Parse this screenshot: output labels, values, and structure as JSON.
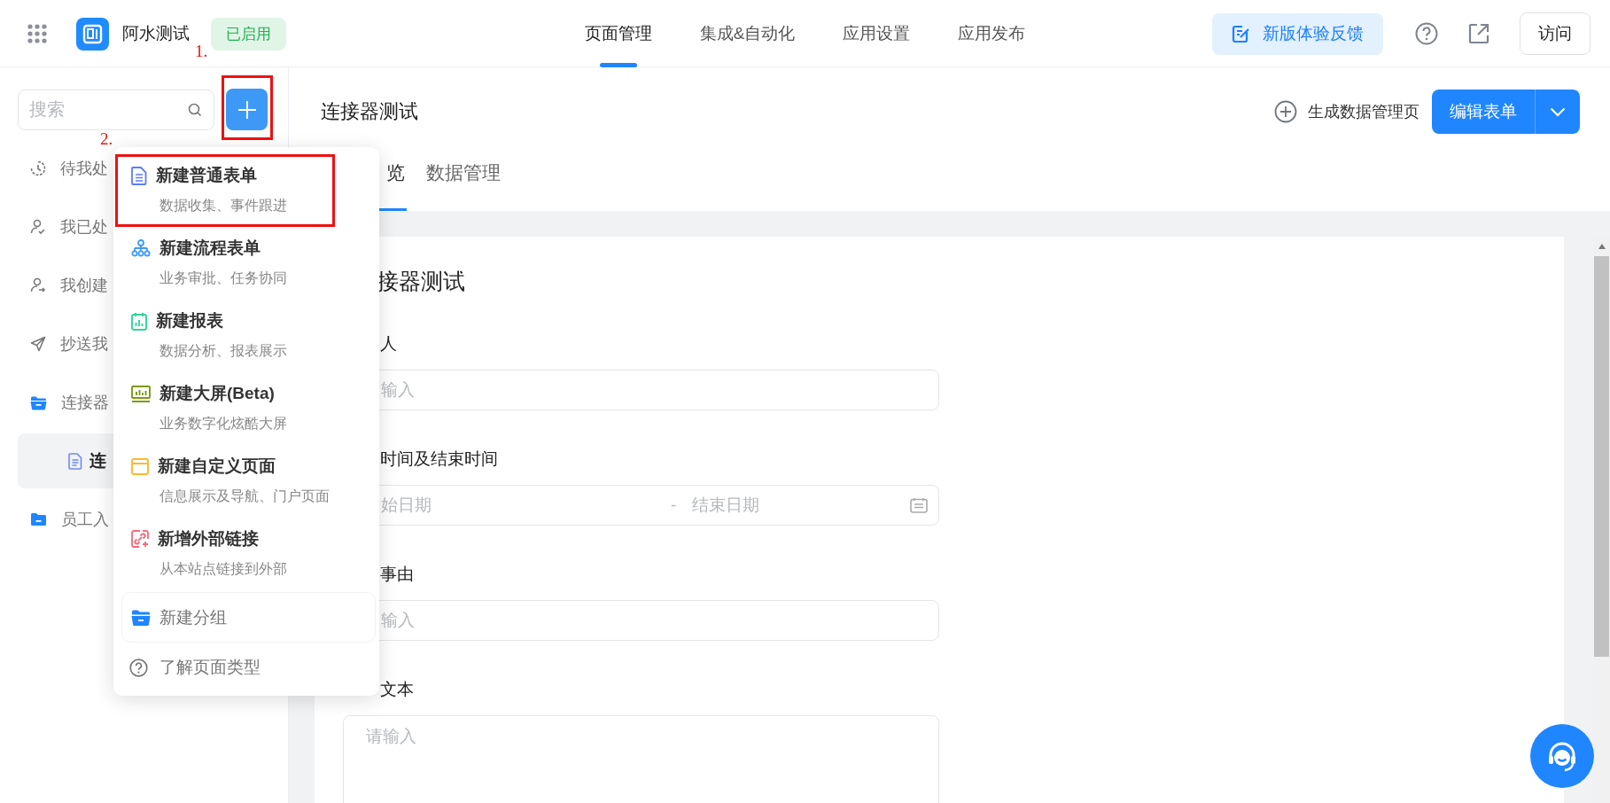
{
  "topbar": {
    "app_name": "阿水测试",
    "status": "已启用",
    "nav": [
      {
        "label": "页面管理",
        "selected": true
      },
      {
        "label": "集成&自动化",
        "selected": false
      },
      {
        "label": "应用设置",
        "selected": false
      },
      {
        "label": "应用发布",
        "selected": false
      }
    ],
    "feedback": "新版体验反馈",
    "visit": "访问"
  },
  "sidebar": {
    "search_placeholder": "搜索",
    "plus_button": {
      "highlighted": true
    },
    "items": [
      {
        "kind": "pending",
        "label": "待我处"
      },
      {
        "kind": "handled",
        "label": "我已处"
      },
      {
        "kind": "created",
        "label": "我创建"
      },
      {
        "kind": "cc",
        "label": "抄送我"
      },
      {
        "kind": "group",
        "label": "连接器",
        "expanded": true,
        "children": [
          {
            "kind": "form",
            "label": "连",
            "selected": true
          }
        ]
      },
      {
        "kind": "group",
        "label": "员工入",
        "expanded": false
      }
    ]
  },
  "page": {
    "title": "连接器测试",
    "generate": "生成数据管理页",
    "edit": "编辑表单",
    "tabs": [
      {
        "label": "览",
        "selected": true
      },
      {
        "label": "数据管理",
        "selected": false
      }
    ],
    "form": {
      "title": "接器测试",
      "fields": [
        {
          "kind": "text",
          "label": "人",
          "placeholder": "输入"
        },
        {
          "kind": "daterange",
          "label": "时间及结束时间",
          "start_placeholder": "始日期",
          "separator": "-",
          "end_placeholder": "结束日期"
        },
        {
          "kind": "text",
          "label": "事由",
          "placeholder": "输入"
        },
        {
          "kind": "textarea",
          "label": "文本",
          "placeholder": "请输入"
        }
      ]
    }
  },
  "menu": {
    "items": [
      {
        "kind": "form",
        "title": "新建普通表单",
        "desc": "数据收集、事件跟进",
        "highlighted": true
      },
      {
        "kind": "flow",
        "title": "新建流程表单",
        "desc": "业务审批、任务协同",
        "highlighted": false
      },
      {
        "kind": "report",
        "title": "新建报表",
        "desc": "数据分析、报表展示",
        "highlighted": false
      },
      {
        "kind": "screen",
        "title": "新建大屏(Beta)",
        "desc": "业务数字化炫酷大屏",
        "highlighted": false
      },
      {
        "kind": "custom",
        "title": "新建自定义页面",
        "desc": "信息展示及导航、门户页面",
        "highlighted": false
      },
      {
        "kind": "link",
        "title": "新增外部链接",
        "desc": "从本站点链接到外部",
        "highlighted": false
      }
    ],
    "group": "新建分组",
    "help": "了解页面类型"
  },
  "annotations": [
    "1.",
    "2."
  ]
}
